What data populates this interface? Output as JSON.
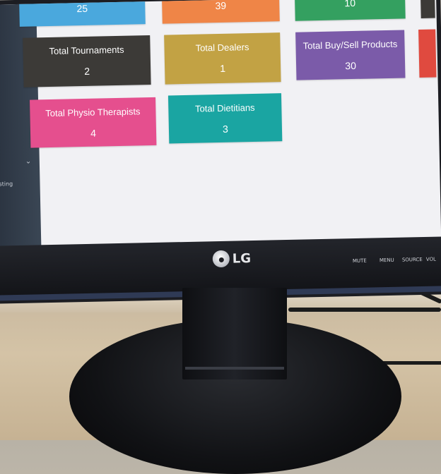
{
  "monitor": {
    "brand": "LG",
    "buttons": [
      "MUTE",
      "MENU",
      "SOURCE",
      "VOL"
    ]
  },
  "screen": {
    "sidebar_snippet": "sting",
    "cards": [
      {
        "label": "",
        "value": "25",
        "color": "#4aa8dd"
      },
      {
        "label": "",
        "value": "39",
        "color": "#ef8547"
      },
      {
        "label": "",
        "value": "10",
        "color": "#34a060"
      },
      {
        "label": "Total Tournaments",
        "value": "2",
        "color": "#3c3a37"
      },
      {
        "label": "Total Dealers",
        "value": "1",
        "color": "#c2a244"
      },
      {
        "label": "Total Buy/Sell Products",
        "value": "30",
        "color": "#7b5ba9"
      },
      {
        "label": "Total Physio Therapists",
        "value": "4",
        "color": "#e54f8e"
      },
      {
        "label": "Total Dietitians",
        "value": "3",
        "color": "#1aa5a2"
      }
    ]
  }
}
